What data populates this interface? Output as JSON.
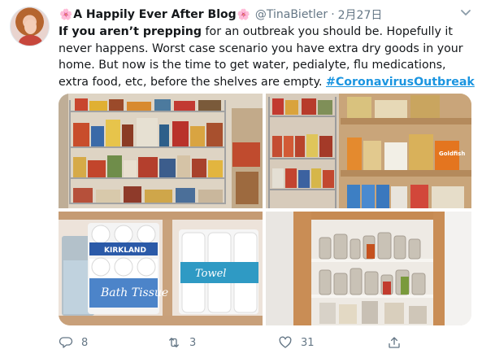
{
  "author": {
    "name": "A Happily Ever After Blog",
    "flower_emoji": "🌸",
    "handle": "@TinaBietler",
    "separator": "·",
    "date": "2月27日",
    "avatar_icon": "profile-photo"
  },
  "tweet": {
    "text_bold": "If you aren’t prepping",
    "text_body": " for an outbreak you should be. Hopefully it never happens. Worst case scenario you have extra dry goods in your home. But now is the time to get water, pedialyte, flu medications, extra food, etc, before the shelves are empty. ",
    "hashtag": "#CoronavirusOutbreak"
  },
  "media": {
    "photos": [
      "pantry-shelves-photo",
      "pantry-corner-photo",
      "toilet-paper-photo",
      "cabinet-jars-photo"
    ]
  },
  "actions": {
    "reply_count": "8",
    "retweet_count": "3",
    "like_count": "31",
    "icons": [
      "reply-icon",
      "retweet-icon",
      "like-icon",
      "share-icon"
    ]
  },
  "colors": {
    "link": "#1b95e0",
    "secondary_text": "#657786",
    "primary_text": "#14171a",
    "flower": "#e35c8f"
  }
}
